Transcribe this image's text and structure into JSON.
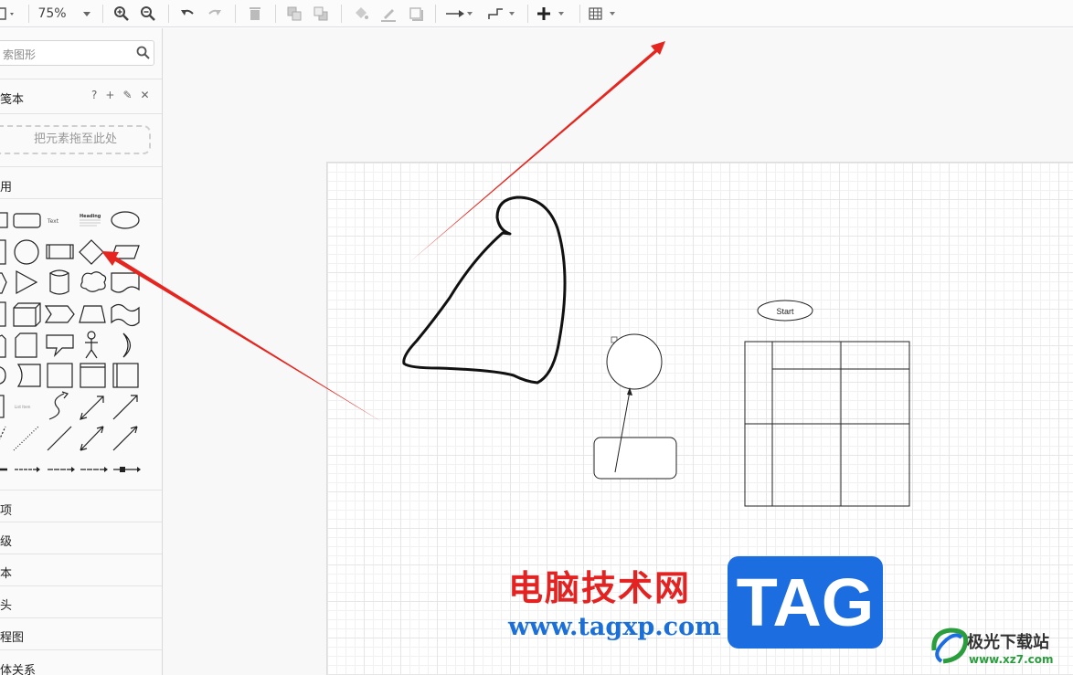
{
  "toolbar": {
    "zoom_value": "75%",
    "items": [
      "page-view",
      "zoom-in",
      "zoom-out",
      "undo",
      "redo",
      "delete",
      "to-front",
      "to-back",
      "fill-color",
      "line-color",
      "shadow",
      "connection-style",
      "waypoints",
      "insert",
      "table"
    ]
  },
  "sidebar": {
    "search_placeholder": "搜索图形",
    "search_visible": "索图形",
    "scratchpad_title": "便笺本",
    "scratchpad_visible": "笺本",
    "scratchpad_actions": [
      "?",
      "+",
      "✎",
      "✕"
    ],
    "drop_hint": "把元素拖至此处",
    "general_visible": "用",
    "shape_text_label": "Text",
    "shape_heading_label": "Heading",
    "shape_list_label": "List Item",
    "sections_visible": [
      "项",
      "级",
      "本",
      "头",
      "程图",
      "体关系"
    ]
  },
  "canvas": {
    "start_label": "Start"
  },
  "watermark": {
    "cn": "电脑技术网",
    "url": "www.tagxp.com",
    "tag": "TAG",
    "site_cn": "极光下载站",
    "site_url": "www.xz7.com"
  },
  "colors": {
    "annotation_arrow": "#e52620",
    "brand_blue": "#1c6ee0",
    "brand_red": "#e32321"
  }
}
